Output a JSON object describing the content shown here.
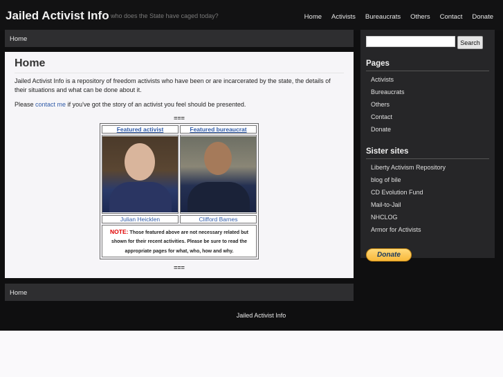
{
  "header": {
    "title": "Jailed Activist Info",
    "tagline": "who does the State have caged today?",
    "nav": [
      "Home",
      "Activists",
      "Bureaucrats",
      "Others",
      "Contact",
      "Donate"
    ]
  },
  "breadcrumb": {
    "label": "Home"
  },
  "main": {
    "title": "Home",
    "intro": "Jailed Activist Info is a repository of freedom activists who have been or are incarcerated by the state, the details of their situations and what can be done about it.",
    "contact_pre": "Please ",
    "contact_link": "contact me",
    "contact_post": " if you've got the story of an activist you feel should be presented.",
    "separator": "===",
    "featured": {
      "activist_header": "Featured activist",
      "bureaucrat_header": "Featured bureaucrat",
      "activist_name": "Julian Heicklen",
      "bureaucrat_name": "Clifford Barnes",
      "note_label": "NOTE:",
      "note_text": " Those featured above are not necessary related but shown for their recent activities. Please be sure to read the appropriate pages for what, who, how and why."
    }
  },
  "sidebar": {
    "search_button": "Search",
    "search_value": "",
    "pages_heading": "Pages",
    "pages": [
      "Activists",
      "Bureaucrats",
      "Others",
      "Contact",
      "Donate"
    ],
    "sister_heading": "Sister sites",
    "sister_sites": [
      "Liberty Activism Repository",
      "blog of bile",
      "CD Evolution Fund",
      "Mail-to-Jail",
      "NHCLOG",
      "Armor for Activists"
    ],
    "donate_button": "Donate"
  },
  "footer": {
    "breadcrumb": "Home",
    "text": "Jailed Activist Info"
  },
  "colors": {
    "background": "#0f0f10",
    "panel": "#2e2e30",
    "link": "#2f5aa8",
    "note": "#e00000"
  }
}
